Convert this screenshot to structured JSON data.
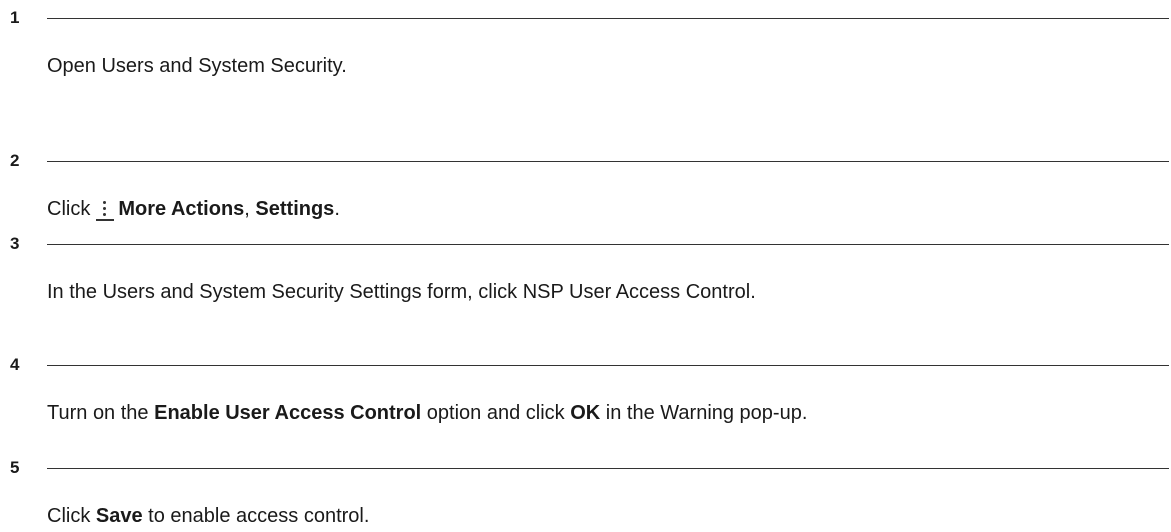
{
  "steps": [
    {
      "number": "1",
      "text": "Open Users and System Security."
    },
    {
      "number": "2",
      "prefix": "Click",
      "icon": "more-actions-kebab-icon",
      "bold1": "More Actions",
      "sep": ", ",
      "bold2": "Settings",
      "suffix": "."
    },
    {
      "number": "3",
      "text": "In the Users and System Security Settings form, click NSP User Access Control."
    },
    {
      "number": "4",
      "prefix": "Turn on the ",
      "bold1": "Enable User Access Control",
      "middle": " option and click ",
      "bold2": "OK",
      "suffix": " in the Warning pop-up."
    },
    {
      "number": "5",
      "prefix": "Click ",
      "bold1": "Save",
      "suffix": " to enable access control."
    }
  ]
}
